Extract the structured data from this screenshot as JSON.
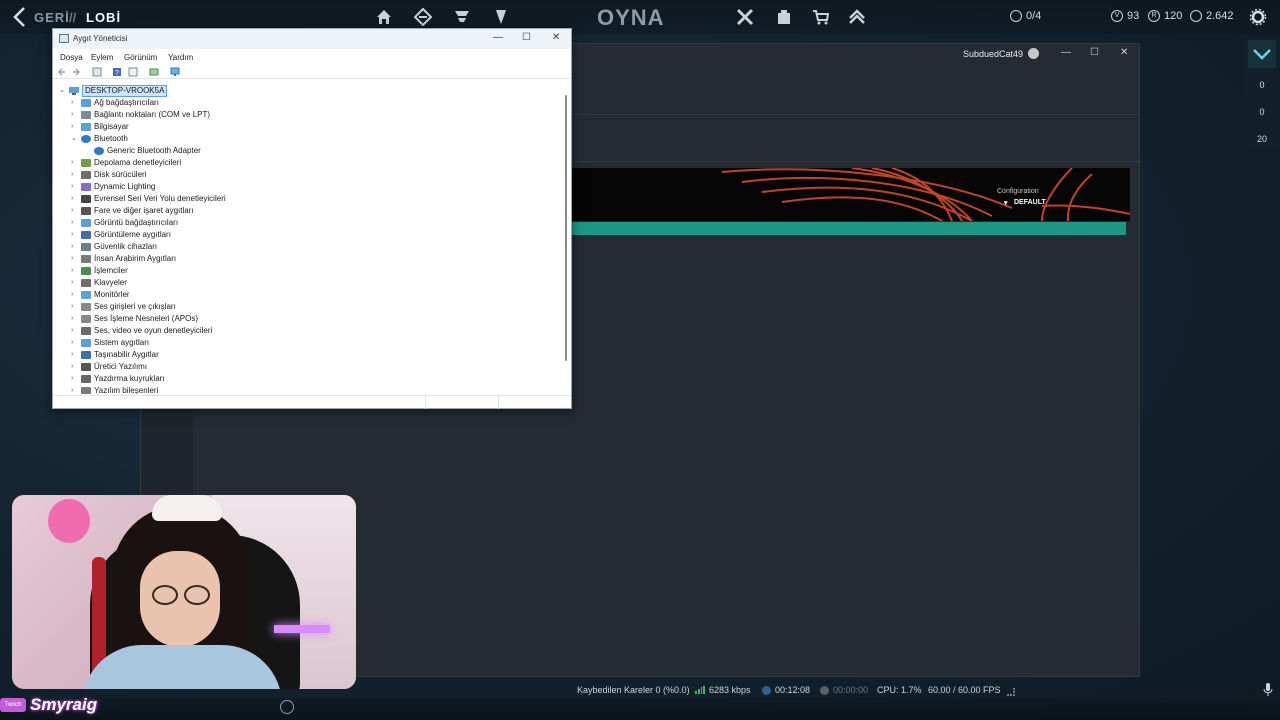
{
  "topbar": {
    "back_label": "GERİ",
    "separator": "//",
    "location_label": "LOBİ",
    "play_label": "OYNA",
    "nav_icons": [
      "home-icon",
      "agents-icon",
      "career-icon",
      "collection-icon",
      "battlepass-icon",
      "store-icon",
      "cart-icon",
      "rank-icon"
    ],
    "party": "0/4",
    "valorant_points": "93",
    "radianite": "120",
    "kingdom_credits": "2.642"
  },
  "right_panel": {
    "values": [
      "0",
      "0",
      "20"
    ]
  },
  "background_window": {
    "username": "SubduedCat49",
    "banner": {
      "config_label": "Configuration",
      "config_value": "DEFAULT",
      "accent_color": "#1e9683",
      "stripe_color": "#e1502e"
    }
  },
  "device_manager": {
    "title": "Aygıt Yöneticisi",
    "menu": [
      "Dosya",
      "Eylem",
      "Görünüm",
      "Yardım"
    ],
    "root": "DESKTOP-VROOK5A",
    "items": [
      {
        "label": "Ağ bağdaştırıcıları",
        "expanded": false
      },
      {
        "label": "Bağlantı noktaları (COM ve LPT)",
        "expanded": false
      },
      {
        "label": "Bilgisayar",
        "expanded": false
      },
      {
        "label": "Bluetooth",
        "expanded": true
      },
      {
        "label": "Generic Bluetooth Adapter",
        "child": true
      },
      {
        "label": "Depolama denetleyicileri",
        "expanded": false
      },
      {
        "label": "Disk sürücüleri",
        "expanded": false
      },
      {
        "label": "Dynamic Lighting",
        "expanded": false
      },
      {
        "label": "Evrensel Seri Veri Yolu denetleyicileri",
        "expanded": false
      },
      {
        "label": "Fare ve diğer işaret aygıtları",
        "expanded": false
      },
      {
        "label": "Görüntü bağdaştırıcıları",
        "expanded": false
      },
      {
        "label": "Görüntüleme aygıtları",
        "expanded": false
      },
      {
        "label": "Güvenlik cihazları",
        "expanded": false
      },
      {
        "label": "İnsan Arabirim Aygıtları",
        "expanded": false
      },
      {
        "label": "İşlemciler",
        "expanded": false
      },
      {
        "label": "Klavyeler",
        "expanded": false
      },
      {
        "label": "Monitörler",
        "expanded": false
      },
      {
        "label": "Ses girişleri ve çıkışları",
        "expanded": false
      },
      {
        "label": "Ses İşleme Nesneleri (APOs)",
        "expanded": false
      },
      {
        "label": "Ses, video ve oyun denetleyicileri",
        "expanded": false
      },
      {
        "label": "Sistem aygıtları",
        "expanded": false
      },
      {
        "label": "Taşınabilir Aygıtlar",
        "expanded": false
      },
      {
        "label": "Üretici Yazılımı",
        "expanded": false
      },
      {
        "label": "Yazdırma kuyrukları",
        "expanded": false
      },
      {
        "label": "Yazılım bileşenleri",
        "expanded": false
      }
    ]
  },
  "stream": {
    "streamer_name": "Smyraig",
    "badge": "Twitch"
  },
  "obs_status": {
    "dropped_frames": "Kaybedilen Kareler 0 (%0.0)",
    "bitrate": "6283 kbps",
    "stream_time": "00:12:08",
    "record_time": "00:00:00",
    "cpu": "CPU: 1.7%",
    "fps": "60.00 / 60.00 FPS"
  }
}
